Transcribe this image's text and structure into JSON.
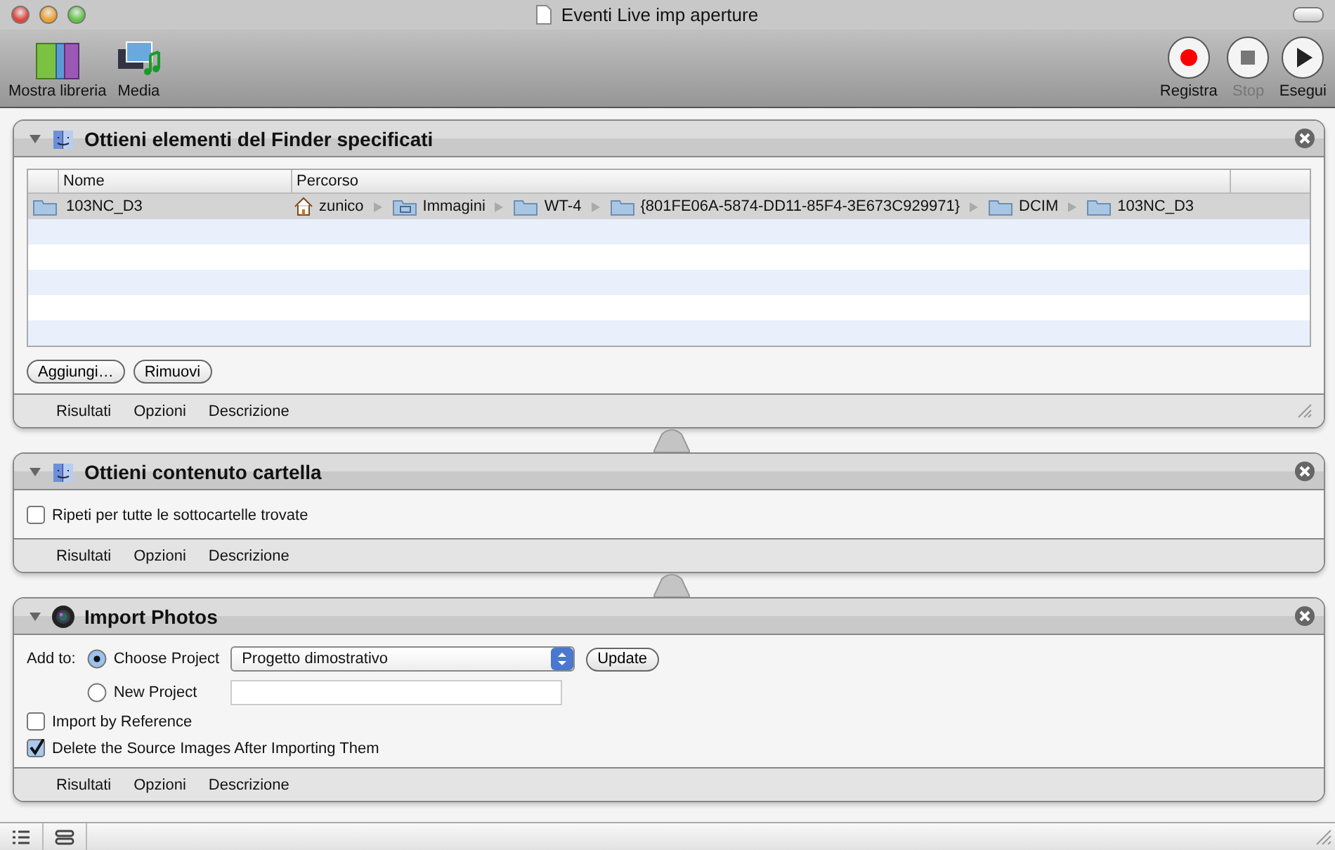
{
  "window": {
    "title": "Eventi Live imp aperture"
  },
  "toolbar": {
    "left": [
      {
        "label": "Mostra libreria",
        "kind": "library"
      },
      {
        "label": "Media",
        "kind": "media"
      }
    ],
    "right": [
      {
        "label": "Registra",
        "kind": "record",
        "disabled": false
      },
      {
        "label": "Stop",
        "kind": "stop",
        "disabled": true
      },
      {
        "label": "Esegui",
        "kind": "run",
        "disabled": false
      }
    ]
  },
  "actions": [
    {
      "title": "Ottieni elementi del Finder specificati",
      "expanded": true,
      "kind": "file_list",
      "table": {
        "columns": [
          "Nome",
          "Percorso"
        ],
        "rows": [
          {
            "name": "103NC_D3",
            "selected": true,
            "path": [
              {
                "label": "zunico",
                "kind": "home"
              },
              {
                "label": "Immagini",
                "kind": "pictures"
              },
              {
                "label": "WT-4",
                "kind": "folder"
              },
              {
                "label": "{801FE06A-5874-DD11-85F4-3E673C929971}",
                "kind": "folder"
              },
              {
                "label": "DCIM",
                "kind": "folder"
              },
              {
                "label": "103NC_D3",
                "kind": "folder"
              }
            ]
          }
        ]
      },
      "buttons": [
        "Aggiungi…",
        "Rimuovi"
      ],
      "footer": [
        "Risultati",
        "Opzioni",
        "Descrizione"
      ]
    },
    {
      "title": "Ottieni contenuto cartella",
      "expanded": true,
      "kind": "options",
      "options": [
        {
          "label": "Ripeti per tutte le sottocartelle trovate",
          "checked": false
        }
      ],
      "footer": [
        "Risultati",
        "Opzioni",
        "Descrizione"
      ]
    },
    {
      "title": "Import Photos",
      "expanded": true,
      "kind": "import",
      "add_to_label": "Add to:",
      "radios": [
        {
          "label": "Choose Project",
          "selected": true,
          "kind": "popup",
          "popup": "Progetto dimostrativo",
          "button": "Update"
        },
        {
          "label": "New Project",
          "selected": false,
          "kind": "text_field"
        }
      ],
      "options": [
        {
          "label": "Import by Reference",
          "checked": false
        },
        {
          "label": "Delete the Source Images After Importing Them",
          "checked": true
        }
      ],
      "footer": [
        "Risultati",
        "Opzioni",
        "Descrizione"
      ]
    }
  ]
}
